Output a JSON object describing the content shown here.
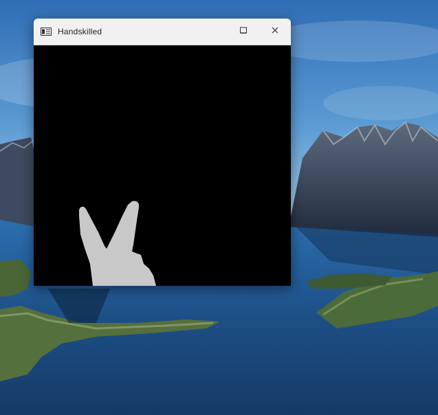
{
  "window": {
    "title": "Handskilled",
    "controls": {
      "minimize_icon": "minimize-icon",
      "close_icon": "close-icon"
    },
    "app_icon": "app-window-icon"
  },
  "content": {
    "mask_color": "#c8c8c8",
    "background_color": "#000000",
    "description_icon": "hand-peace-sign-mask"
  },
  "colors": {
    "titlebar": "#f1f1f1",
    "sky": "#3d7fc2",
    "water": "#1f4f86"
  }
}
